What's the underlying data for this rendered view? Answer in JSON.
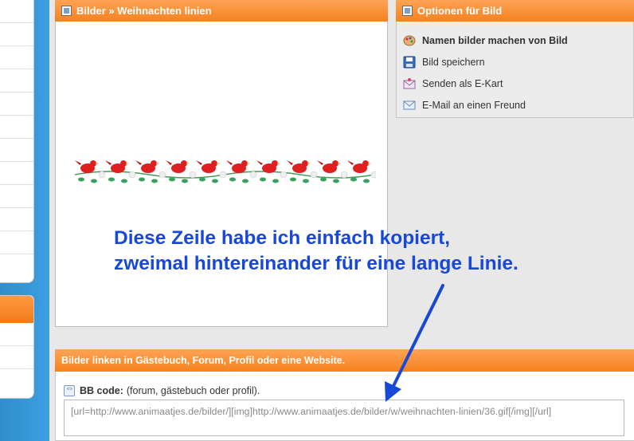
{
  "main_panel": {
    "title": "Bilder » Weihnachten linien"
  },
  "options": {
    "title": "Optionen für Bild",
    "items": [
      {
        "label": "Namen bilder machen von Bild",
        "icon": "palette-icon",
        "bold": true
      },
      {
        "label": "Bild speichern",
        "icon": "floppy-disk-icon",
        "bold": false
      },
      {
        "label": "Senden als E-Kart",
        "icon": "ecard-icon",
        "bold": false
      },
      {
        "label": "E-Mail an einen Freund",
        "icon": "envelope-icon",
        "bold": false
      }
    ]
  },
  "annotation": {
    "line1": "Diese Zeile habe ich einfach kopiert,",
    "line2": "zweimal hintereinander für eine lange Linie."
  },
  "links_panel": {
    "title": "Bilder linken in Gästebuch, Forum, Profil oder eine Website.",
    "bb_label": "BB code:",
    "bb_hint": "(forum, gästebuch oder profil).",
    "bb_value": "[url=http://www.animaatjes.de/bilder/][img]http://www.animaatjes.de/bilder/w/weihnachten-linien/36.gif[/img][/url]"
  },
  "colors": {
    "accent_orange": "#f5821f",
    "annotation_blue": "#1848d8",
    "sidebar_blue": "#3d9fe0"
  }
}
